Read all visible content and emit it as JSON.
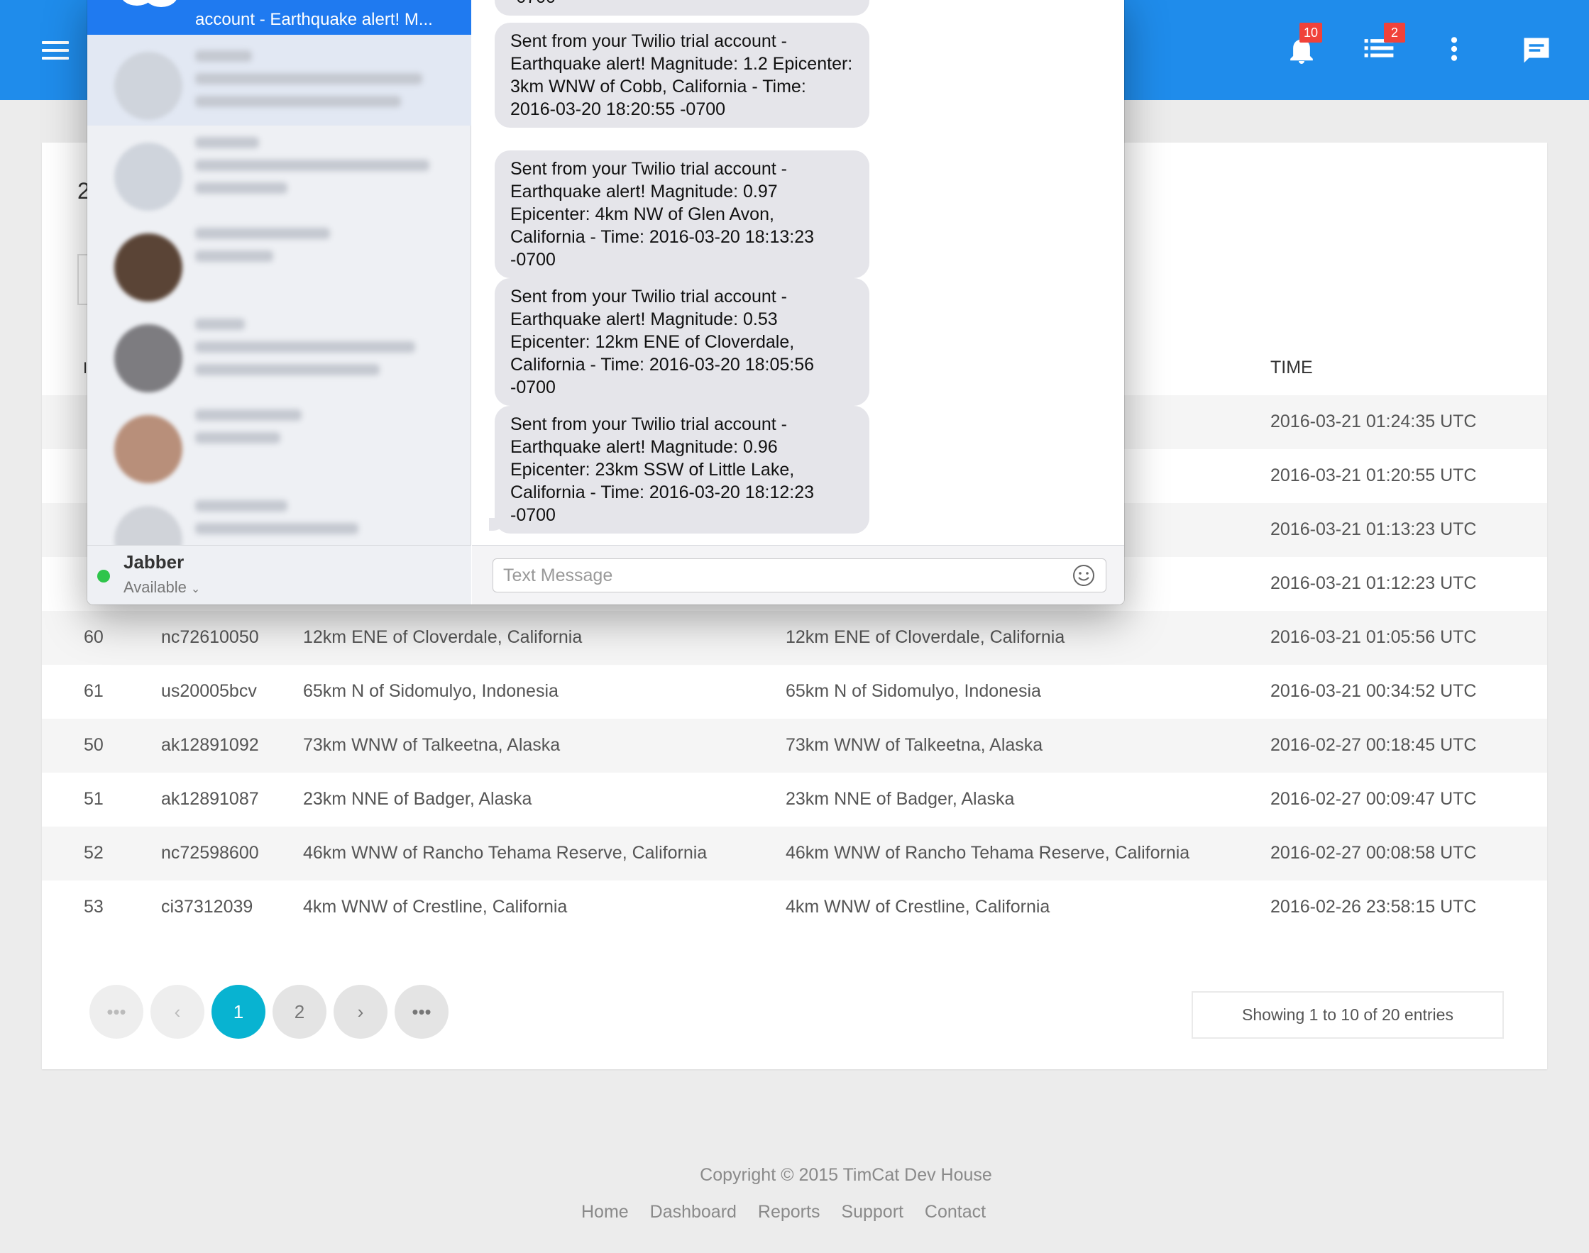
{
  "topbar": {
    "notifications_count": "10",
    "tasks_count": "2",
    "accent": "#1f8ceb",
    "icons": [
      "menu-icon",
      "bell-icon",
      "list-icon",
      "more-vert-icon",
      "chat-icon"
    ]
  },
  "table": {
    "time_header": "TIME",
    "rows_partial": [
      {
        "time": "2016-03-21 01:24:35 UTC"
      },
      {
        "time": "2016-03-21 01:20:55 UTC"
      },
      {
        "time": "2016-03-21 01:13:23 UTC"
      },
      {
        "time": "2016-03-21 01:12:23 UTC"
      }
    ],
    "rows": [
      {
        "id": "60",
        "code": "nc72610050",
        "place": "12km ENE of Cloverdale, California",
        "place2": "12km ENE of Cloverdale, California",
        "time": "2016-03-21 01:05:56 UTC"
      },
      {
        "id": "61",
        "code": "us20005bcv",
        "place": "65km N of Sidomulyo, Indonesia",
        "place2": "65km N of Sidomulyo, Indonesia",
        "time": "2016-03-21 00:34:52 UTC"
      },
      {
        "id": "50",
        "code": "ak12891092",
        "place": "73km WNW of Talkeetna, Alaska",
        "place2": "73km WNW of Talkeetna, Alaska",
        "time": "2016-02-27 00:18:45 UTC"
      },
      {
        "id": "51",
        "code": "ak12891087",
        "place": "23km NNE of Badger, Alaska",
        "place2": "23km NNE of Badger, Alaska",
        "time": "2016-02-27 00:09:47 UTC"
      },
      {
        "id": "52",
        "code": "nc72598600",
        "place": "46km WNW of Rancho Tehama Reserve, California",
        "place2": "46km WNW of Rancho Tehama Reserve, California",
        "time": "2016-02-27 00:08:58 UTC"
      },
      {
        "id": "53",
        "code": "ci37312039",
        "place": "4km WNW of Crestline, California",
        "place2": "4km WNW of Crestline, California",
        "time": "2016-02-26 23:58:15 UTC"
      }
    ]
  },
  "pagination": {
    "first": "•••",
    "prev": "‹",
    "pages": [
      "1",
      "2"
    ],
    "active": "1",
    "next": "›",
    "last": "•••",
    "info": "Showing 1 to 10 of 20 entries"
  },
  "footer": {
    "copyright": "Copyright © 2015 TimCat Dev House",
    "links": [
      "Home",
      "Dashboard",
      "Reports",
      "Support",
      "Contact"
    ]
  },
  "messages": {
    "active_conversation_preview": "account - Earthquake alert! M...",
    "status_service": "Jabber",
    "status_value": "Available",
    "composer_placeholder": "Text Message",
    "top_fragment": "-0700",
    "bubbles": [
      "Sent from your Twilio trial account - Earthquake alert! Magnitude: 1.2 Epicenter: 3km WNW of Cobb, California - Time: 2016-03-20 18:20:55 -0700",
      "Sent from your Twilio trial account - Earthquake alert! Magnitude: 0.97 Epicenter: 4km NW of Glen Avon, California - Time: 2016-03-20 18:13:23 -0700",
      "Sent from your Twilio trial account - Earthquake alert! Magnitude: 0.53 Epicenter: 12km ENE of Cloverdale, California - Time: 2016-03-20 18:05:56 -0700",
      "Sent from your Twilio trial account - Earthquake alert! Magnitude: 0.96 Epicenter: 23km SSW of Little Lake, California - Time: 2016-03-20 18:12:23 -0700"
    ]
  }
}
